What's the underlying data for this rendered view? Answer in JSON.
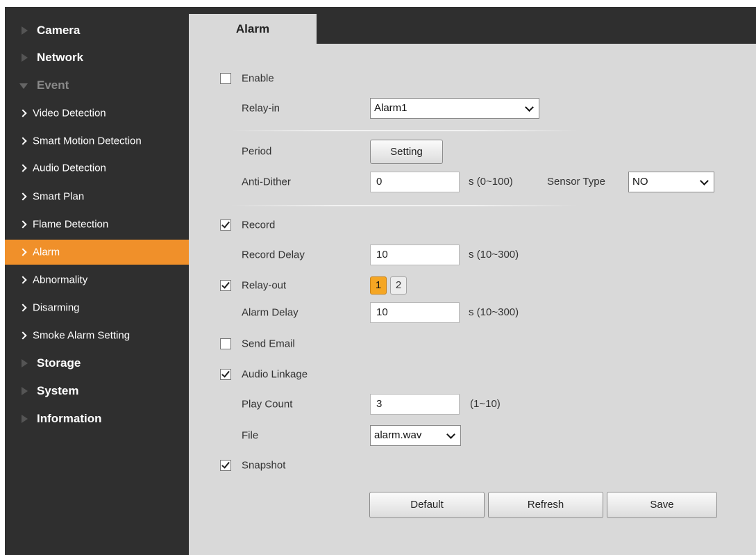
{
  "sidebar": {
    "camera": "Camera",
    "network": "Network",
    "event": "Event",
    "event_items": {
      "video_detection": "Video Detection",
      "smart_motion_detection": "Smart Motion Detection",
      "audio_detection": "Audio Detection",
      "smart_plan": "Smart Plan",
      "flame_detection": "Flame Detection",
      "alarm": "Alarm",
      "abnormality": "Abnormality",
      "disarming": "Disarming",
      "smoke_alarm_setting": "Smoke Alarm Setting"
    },
    "storage": "Storage",
    "system": "System",
    "information": "Information",
    "active_item": "Alarm",
    "active_color": "#f0902a"
  },
  "tab": {
    "label": "Alarm"
  },
  "form": {
    "enable": {
      "label": "Enable",
      "checked": false
    },
    "relay_in": {
      "label": "Relay-in",
      "value": "Alarm1"
    },
    "period": {
      "label": "Period",
      "button": "Setting"
    },
    "anti_dither": {
      "label": "Anti-Dither",
      "value": "0",
      "unit": "s (0~100)"
    },
    "sensor_type": {
      "label": "Sensor Type",
      "value": "NO"
    },
    "record": {
      "label": "Record",
      "checked": true
    },
    "record_delay": {
      "label": "Record Delay",
      "value": "10",
      "unit": "s (10~300)"
    },
    "relay_out": {
      "label": "Relay-out",
      "checked": true,
      "channels": [
        "1",
        "2"
      ],
      "selected": "1"
    },
    "alarm_delay": {
      "label": "Alarm Delay",
      "value": "10",
      "unit": "s (10~300)"
    },
    "send_email": {
      "label": "Send Email",
      "checked": false
    },
    "audio_linkage": {
      "label": "Audio Linkage",
      "checked": true
    },
    "play_count": {
      "label": "Play Count",
      "value": "3",
      "unit": "(1~10)"
    },
    "file": {
      "label": "File",
      "value": "alarm.wav"
    },
    "snapshot": {
      "label": "Snapshot",
      "checked": true
    }
  },
  "buttons": {
    "default": "Default",
    "refresh": "Refresh",
    "save": "Save"
  },
  "icons": {
    "collapsed_section": "triangle-right-icon",
    "expanded_section": "triangle-down-icon",
    "sub_item": "chevron-right-icon",
    "dropdown": "chevron-down-icon",
    "checkbox": "checkmark-icon"
  }
}
